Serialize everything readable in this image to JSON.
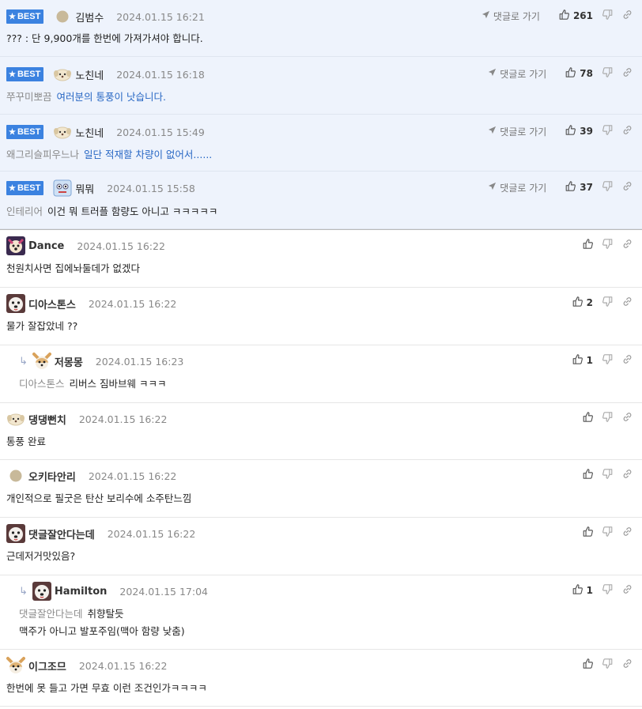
{
  "best_label": "BEST",
  "goto_label": "댓글로 가기",
  "best_comments": [
    {
      "nick": "김범수",
      "date": "2024.01.15 16:21",
      "mention": "",
      "text": "??? : 단 9,900개를 한번에 가져가셔야 합니다.",
      "text_style": "plain",
      "likes": "261",
      "avatar": "plain-dot-avatar"
    },
    {
      "nick": "노친네",
      "date": "2024.01.15 16:18",
      "mention": "쭈꾸미뽀끔",
      "text": "여러분의 통풍이 낫습니다.",
      "text_style": "blue",
      "likes": "78",
      "avatar": "puppy-avatar"
    },
    {
      "nick": "노친네",
      "date": "2024.01.15 15:49",
      "mention": "왜그리슬피우느나",
      "text": "일단 적재할 차량이 없어서......",
      "text_style": "blue",
      "likes": "39",
      "avatar": "puppy-avatar"
    },
    {
      "nick": "뭐뭐",
      "date": "2024.01.15 15:58",
      "mention": "인테리어",
      "text": "이건 뭐 트러플 함량도 아니고 ㅋㅋㅋㅋㅋ",
      "text_style": "plain",
      "likes": "37",
      "avatar": "robot-avatar"
    }
  ],
  "comments": [
    {
      "nick": "Dance",
      "date": "2024.01.15 16:22",
      "mention": "",
      "lines": [
        "천원치사면 집에놔둘데가 없겠다"
      ],
      "likes": "",
      "reply": false,
      "avatar": "dog-face-avatar"
    },
    {
      "nick": "디아스톤스",
      "date": "2024.01.15 16:22",
      "mention": "",
      "lines": [
        "물가 잘잡았네 ??"
      ],
      "likes": "2",
      "reply": false,
      "avatar": "dog-white-avatar"
    },
    {
      "nick": "저몽몽",
      "date": "2024.01.15 16:23",
      "mention": "디아스톤스",
      "lines": [
        "리버스 짐바브웨 ㅋㅋㅋ"
      ],
      "likes": "1",
      "reply": true,
      "avatar": "fox-avatar"
    },
    {
      "nick": "댕댕뻔치",
      "date": "2024.01.15 16:22",
      "mention": "",
      "lines": [
        "통풍 완료"
      ],
      "likes": "",
      "reply": false,
      "avatar": "puppy-avatar"
    },
    {
      "nick": "오키타안리",
      "date": "2024.01.15 16:22",
      "mention": "",
      "lines": [
        "개인적으로 필굿은 탄산 보리수에 소주탄느낌"
      ],
      "likes": "",
      "reply": false,
      "avatar": "plain-dot-avatar"
    },
    {
      "nick": "댓글잘안다는데",
      "date": "2024.01.15 16:22",
      "mention": "",
      "lines": [
        "근데저거맛있음?"
      ],
      "likes": "",
      "reply": false,
      "avatar": "dog-white-avatar"
    },
    {
      "nick": "Hamilton",
      "date": "2024.01.15 17:04",
      "mention": "댓글잘안다는데",
      "lines": [
        "취향탈듯",
        "맥주가 아니고 발포주임(맥아 함량 낮춤)"
      ],
      "likes": "1",
      "reply": true,
      "avatar": "dog-white-avatar"
    },
    {
      "nick": "이그조므",
      "date": "2024.01.15 16:22",
      "mention": "",
      "lines": [
        "한번에 못 들고 가면 무효 이런 조건인가ㅋㅋㅋㅋ"
      ],
      "likes": "",
      "reply": false,
      "avatar": "fox-avatar"
    }
  ],
  "colors": {
    "best_bg": "#eef3fc",
    "badge": "#3b82e0",
    "blue_text": "#2767c4"
  },
  "icons": {
    "like": "thumbs-up-icon",
    "dislike": "thumbs-down-icon",
    "link": "link-icon",
    "goto": "send-arrow-icon",
    "reply": "reply-arrow-icon"
  }
}
